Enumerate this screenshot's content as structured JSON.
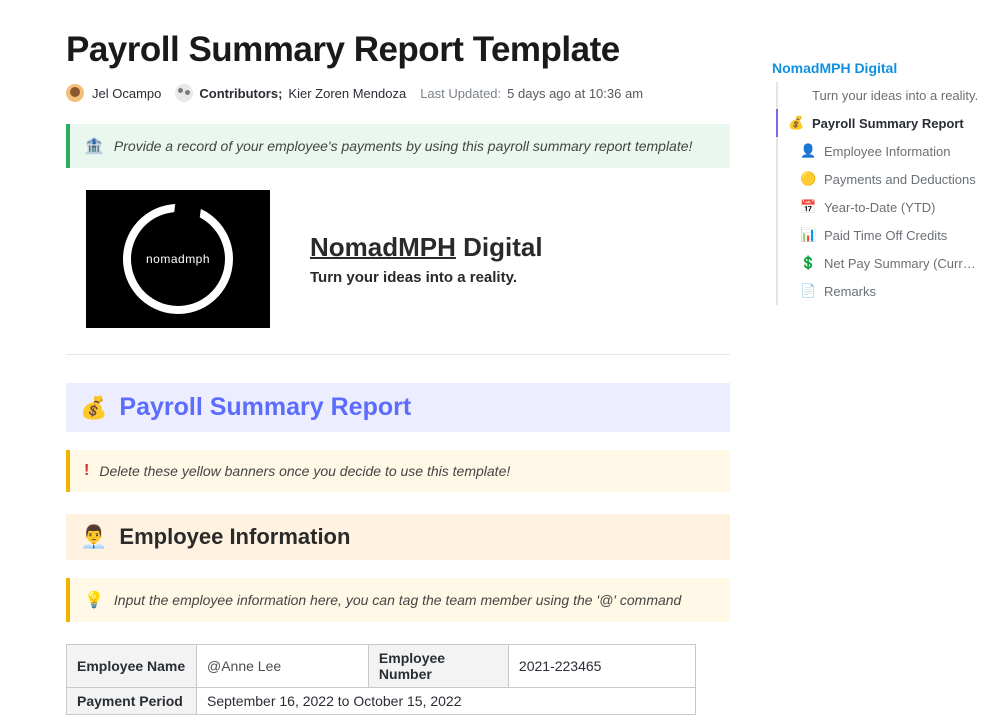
{
  "page": {
    "title": "Payroll Summary Report Template"
  },
  "meta": {
    "author": "Jel Ocampo",
    "contributors_label": "Contributors;",
    "contributors": "Kier Zoren Mendoza",
    "updated_label": "Last Updated:",
    "updated_value": "5 days ago at 10:36 am"
  },
  "banners": {
    "intro": "Provide a record of your employee's payments by using this payroll summary report template!",
    "delete_hint": "Delete these yellow banners once you decide to use this template!",
    "emp_hint": "Input the employee information here, you can tag the team member using the '@' command"
  },
  "brand": {
    "logo_text": "nomadmph",
    "name_underlined": "NomadMPH",
    "name_rest": " Digital",
    "tagline": "Turn your ideas into a reality."
  },
  "sections": {
    "payroll_title": "Payroll Summary Report",
    "employee_title": "Employee Information"
  },
  "employee_table": {
    "name_label": "Employee Name",
    "name_value": "@Anne Lee",
    "number_label": "Employee Number",
    "number_value": "2021-223465",
    "period_label": "Payment Period",
    "period_value": "September 16, 2022 to October 15, 2022"
  },
  "sidebar": {
    "title": "NomadMPH Digital",
    "items": [
      {
        "icon": "",
        "label": "Turn your ideas into a reality.",
        "sub": false,
        "active": false
      },
      {
        "icon": "💰",
        "label": "Payroll Summary Report",
        "sub": false,
        "active": true
      },
      {
        "icon": "👤",
        "label": "Employee Information",
        "sub": true,
        "active": false
      },
      {
        "icon": "🟡",
        "label": "Payments and Deductions",
        "sub": true,
        "active": false
      },
      {
        "icon": "📅",
        "label": "Year-to-Date (YTD)",
        "sub": true,
        "active": false
      },
      {
        "icon": "📊",
        "label": "Paid Time Off Credits",
        "sub": true,
        "active": false
      },
      {
        "icon": "💲",
        "label": "Net Pay Summary (Current Pay Pe...",
        "sub": true,
        "active": false
      },
      {
        "icon": "📄",
        "label": "Remarks",
        "sub": true,
        "active": false
      }
    ]
  }
}
